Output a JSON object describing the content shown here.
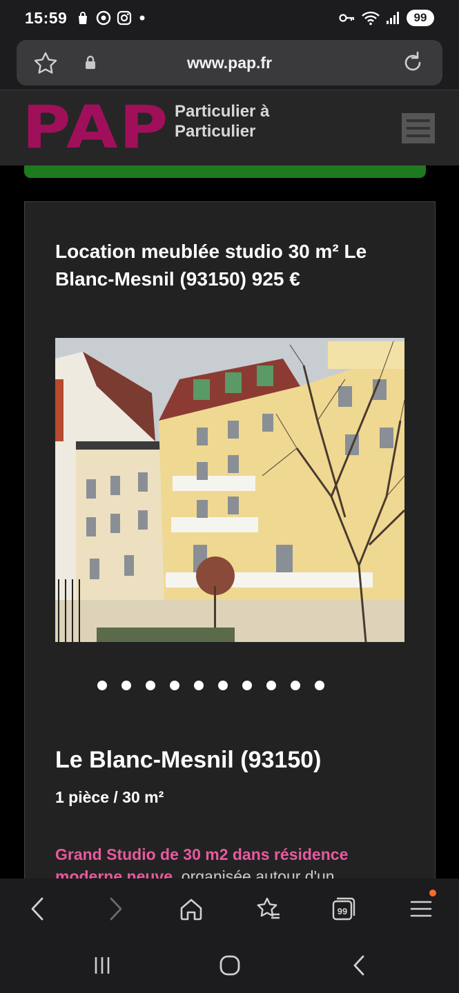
{
  "status_bar": {
    "time": "15:59",
    "icons_left": [
      "shopping-bag-icon",
      "chrome-icon",
      "instagram-icon",
      "dot-icon"
    ],
    "icons_right": [
      "key-icon",
      "wifi-icon",
      "signal-icon"
    ],
    "battery": "99"
  },
  "browser": {
    "url": "www.pap.fr",
    "tab_count": "99"
  },
  "site": {
    "logo": "PAP",
    "tagline_line1": "Particulier à",
    "tagline_line2": "Particulier",
    "brand_color": "#a0105a"
  },
  "listing": {
    "title": "Location meublée studio 30 m² Le Blanc-Mesnil (93150) 925 €",
    "photo_count": 10,
    "active_photo": 1,
    "location": "Le Blanc-Mesnil (93150)",
    "specs": "1 pièce  /  30 m²",
    "description_highlight": "Grand Studio de 30 m2 dans résidence moderne neuve",
    "description_rest": ", organisée autour d'un"
  }
}
